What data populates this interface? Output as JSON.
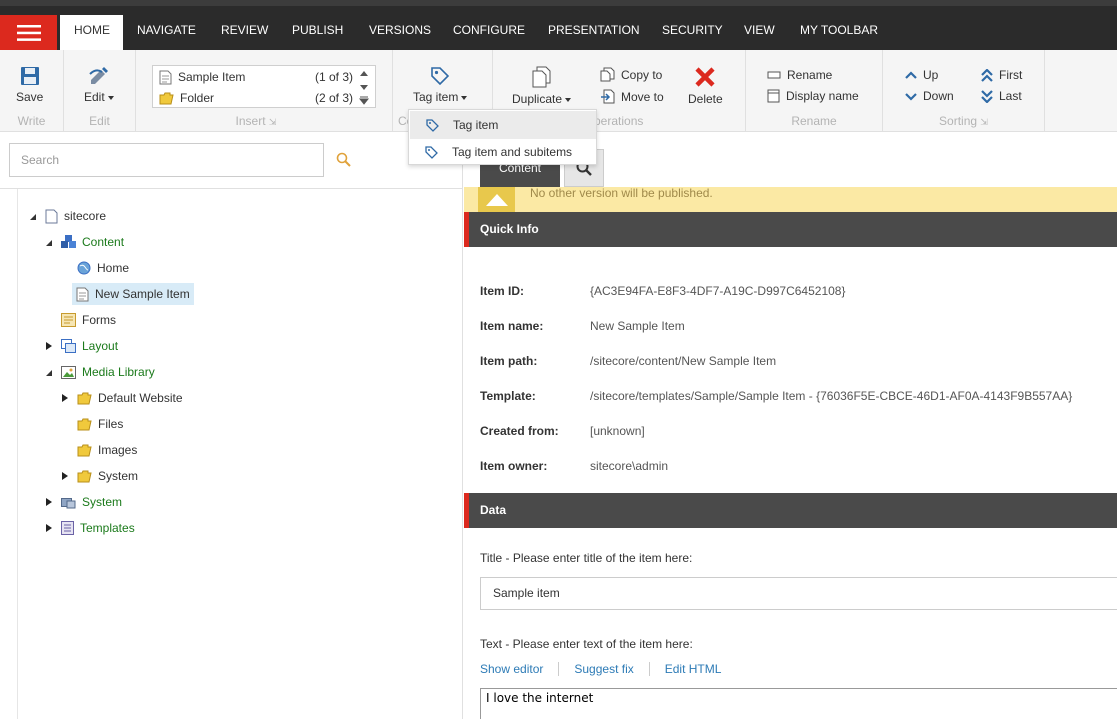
{
  "tabs": [
    "HOME",
    "NAVIGATE",
    "REVIEW",
    "PUBLISH",
    "VERSIONS",
    "CONFIGURE",
    "PRESENTATION",
    "SECURITY",
    "VIEW",
    "MY TOOLBAR"
  ],
  "ribbon": {
    "write": {
      "save": "Save",
      "label": "Write"
    },
    "edit": {
      "edit": "Edit",
      "label": "Edit"
    },
    "insert": {
      "items": [
        {
          "name": "Sample Item",
          "count": "(1 of 3)"
        },
        {
          "name": "Folder",
          "count": "(2 of 3)"
        }
      ],
      "label": "Insert"
    },
    "tag": {
      "label": "Tag item",
      "group_label": "Co"
    },
    "operations": {
      "duplicate": "Duplicate",
      "copy_to": "Copy to",
      "move_to": "Move to",
      "delete": "Delete",
      "label": "perations"
    },
    "rename": {
      "rename": "Rename",
      "display_name": "Display name",
      "label": "Rename"
    },
    "sorting": {
      "up": "Up",
      "down": "Down",
      "first": "First",
      "last": "Last",
      "label": "Sorting"
    }
  },
  "tag_dropdown": {
    "items": [
      "Tag item",
      "Tag item and subitems"
    ]
  },
  "search": {
    "placeholder": "Search"
  },
  "tree": {
    "sitecore": "sitecore",
    "content": "Content",
    "home": "Home",
    "new_sample_item": "New Sample Item",
    "forms": "Forms",
    "layout": "Layout",
    "media_library": "Media Library",
    "default_website": "Default Website",
    "files": "Files",
    "images": "Images",
    "media_system": "System",
    "system": "System",
    "templates": "Templates"
  },
  "content_editor": {
    "tab": "Content",
    "warning": "No other version will be published.",
    "quick_info": {
      "title": "Quick Info",
      "rows": [
        {
          "k": "Item ID:",
          "v": "{AC3E94FA-E8F3-4DF7-A19C-D997C6452108}"
        },
        {
          "k": "Item name:",
          "v": "New Sample Item"
        },
        {
          "k": "Item path:",
          "v": "/sitecore/content/New Sample Item"
        },
        {
          "k": "Template:",
          "v": "/sitecore/templates/Sample/Sample Item - {76036F5E-CBCE-46D1-AF0A-4143F9B557AA}"
        },
        {
          "k": "Created from:",
          "v": "[unknown]"
        },
        {
          "k": "Item owner:",
          "v": "sitecore\\admin"
        }
      ]
    },
    "data": {
      "title": "Data",
      "title_field_label": "Title - Please enter title of the item here:",
      "title_field_value": "Sample item",
      "text_field_label": "Text - Please enter text of the item here:",
      "links": [
        "Show editor",
        "Suggest fix",
        "Edit HTML"
      ],
      "text_value": "I love the internet"
    }
  },
  "colors": {
    "accent": "#dc291e",
    "dark": "#2b2b2b",
    "tree_green": "#1b7a1b",
    "link": "#2d7bb6"
  }
}
